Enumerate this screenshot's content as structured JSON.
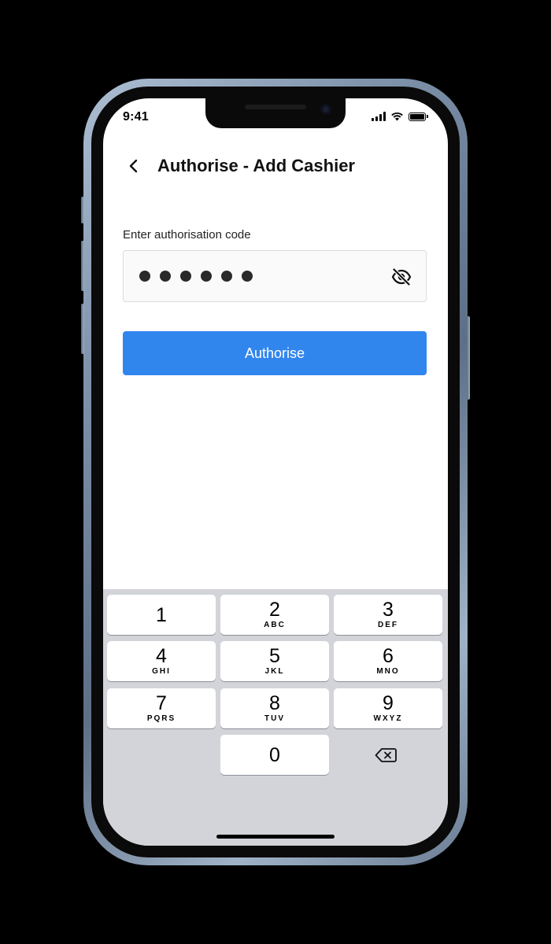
{
  "status_bar": {
    "time": "9:41",
    "signal_icon": "cellular-signal-icon",
    "wifi_icon": "wifi-icon",
    "battery_icon": "battery-icon"
  },
  "header": {
    "back_icon": "chevron-left-icon",
    "title": "Authorise - Add Cashier"
  },
  "form": {
    "label": "Enter authorisation code",
    "masked_value_length": 6,
    "visibility_icon": "eye-off-icon"
  },
  "actions": {
    "authorise_label": "Authorise",
    "accent_color": "#3186ee"
  },
  "keypad": {
    "keys": [
      {
        "digit": "1",
        "letters": ""
      },
      {
        "digit": "2",
        "letters": "ABC"
      },
      {
        "digit": "3",
        "letters": "DEF"
      },
      {
        "digit": "4",
        "letters": "GHI"
      },
      {
        "digit": "5",
        "letters": "JKL"
      },
      {
        "digit": "6",
        "letters": "MNO"
      },
      {
        "digit": "7",
        "letters": "PQRS"
      },
      {
        "digit": "8",
        "letters": "TUV"
      },
      {
        "digit": "9",
        "letters": "WXYZ"
      },
      {
        "digit": "0",
        "letters": ""
      }
    ],
    "backspace_icon": "backspace-icon"
  }
}
